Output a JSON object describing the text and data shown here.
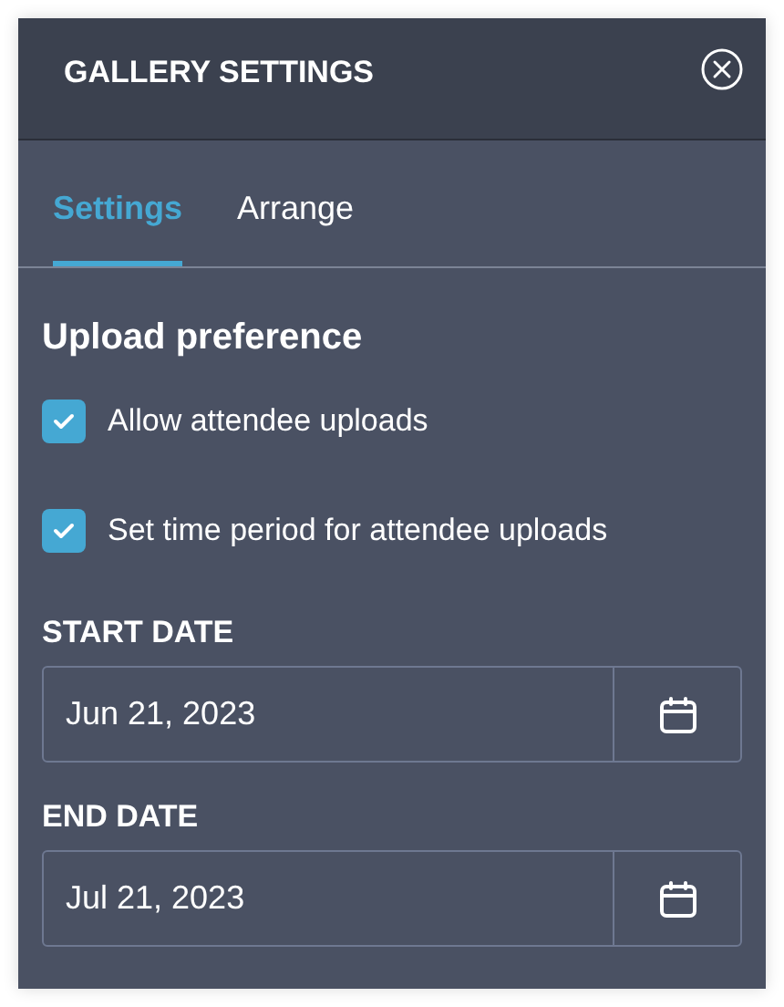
{
  "header": {
    "title": "GALLERY SETTINGS"
  },
  "tabs": [
    {
      "label": "Settings",
      "selected": true
    },
    {
      "label": "Arrange",
      "selected": false
    }
  ],
  "section": {
    "heading": "Upload preference"
  },
  "options": [
    {
      "label": "Allow attendee uploads",
      "checked": true
    },
    {
      "label": "Set time period for attendee uploads",
      "checked": true
    }
  ],
  "dates": [
    {
      "label": "START DATE",
      "value": "Jun 21, 2023"
    },
    {
      "label": "END DATE",
      "value": "Jul 21, 2023"
    }
  ]
}
